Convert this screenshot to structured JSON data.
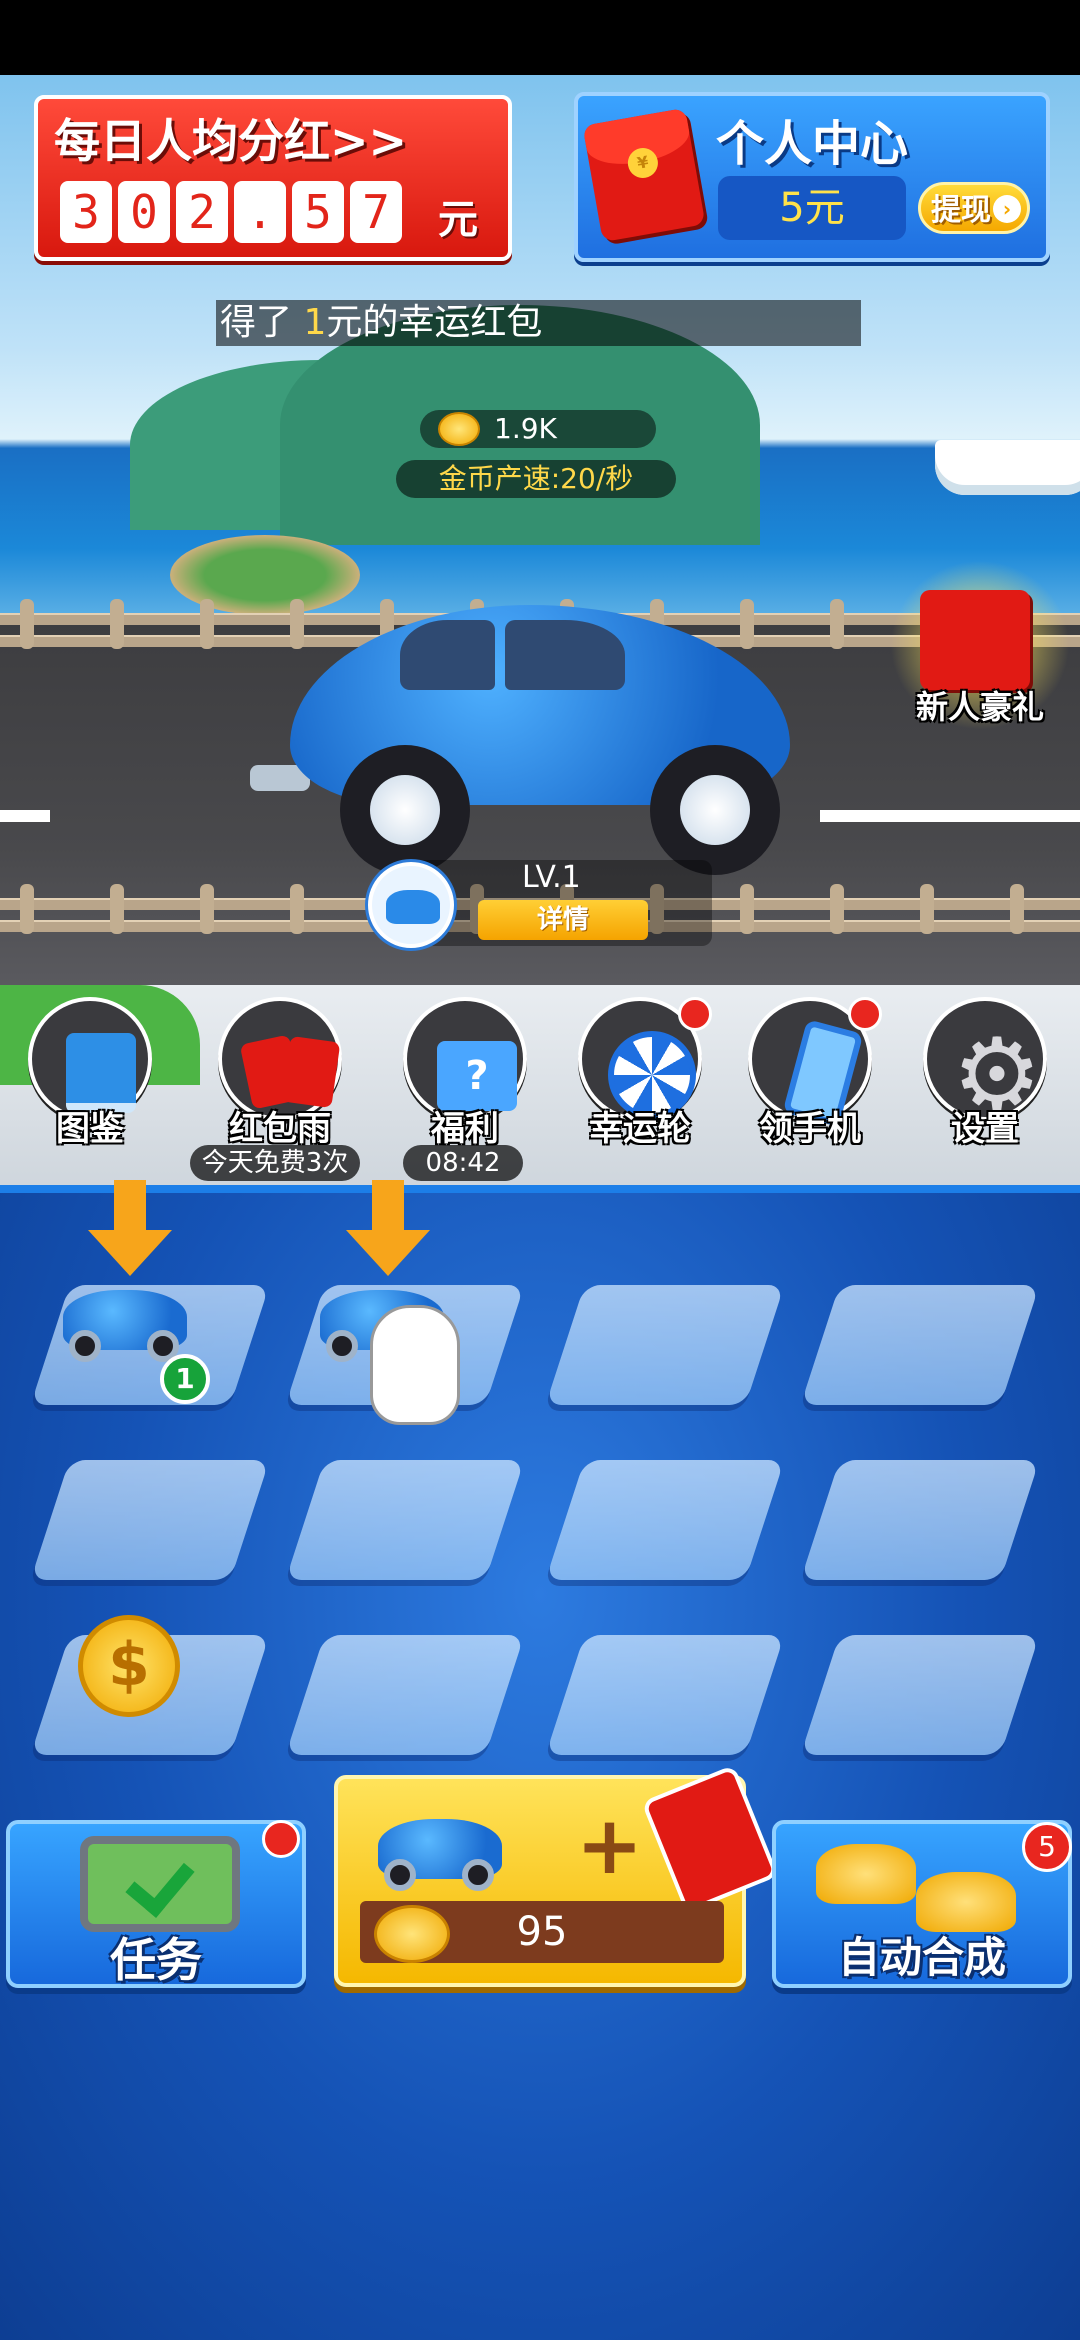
{
  "dividend": {
    "title": "每日人均分红>>",
    "digits": [
      "3",
      "0",
      "2",
      ".",
      "5",
      "7"
    ],
    "unit": "元"
  },
  "personal_center": {
    "title": "个人中心",
    "balance": "5元",
    "withdraw_label": "提现",
    "packet_symbol": "¥"
  },
  "ticker": {
    "prefix": "得了 ",
    "amount": "1",
    "suffix": "元的幸运红包"
  },
  "stats": {
    "coins": "1.9K",
    "rate": "金币产速:20/秒"
  },
  "current_car": {
    "level": "LV.1",
    "detail_label": "详情"
  },
  "newbie_gift": {
    "label": "新人豪礼"
  },
  "toolbar": {
    "items": [
      {
        "label": "图鉴",
        "icon": "book-icon"
      },
      {
        "label": "红包雨",
        "icon": "red-packets-icon",
        "sub": "今天免费3次"
      },
      {
        "label": "福利",
        "icon": "gift-box-icon",
        "sub": "08:42"
      },
      {
        "label": "幸运轮",
        "icon": "lucky-wheel-icon",
        "notify": true
      },
      {
        "label": "领手机",
        "icon": "phone-icon",
        "notify": true
      },
      {
        "label": "设置",
        "icon": "gear-icon"
      }
    ]
  },
  "board": {
    "slot_car_1_level": "1",
    "coin_symbol": "$"
  },
  "bottom": {
    "tasks_label": "任务",
    "buy_price": "95",
    "buy_plus": "+",
    "auto_merge_label": "自动合成",
    "auto_merge_badge": "5"
  },
  "colors": {
    "red_panel": "#e2251a",
    "blue_panel": "#1f6fe0",
    "gold": "#f5b800",
    "board_blue": "#1553b6"
  }
}
